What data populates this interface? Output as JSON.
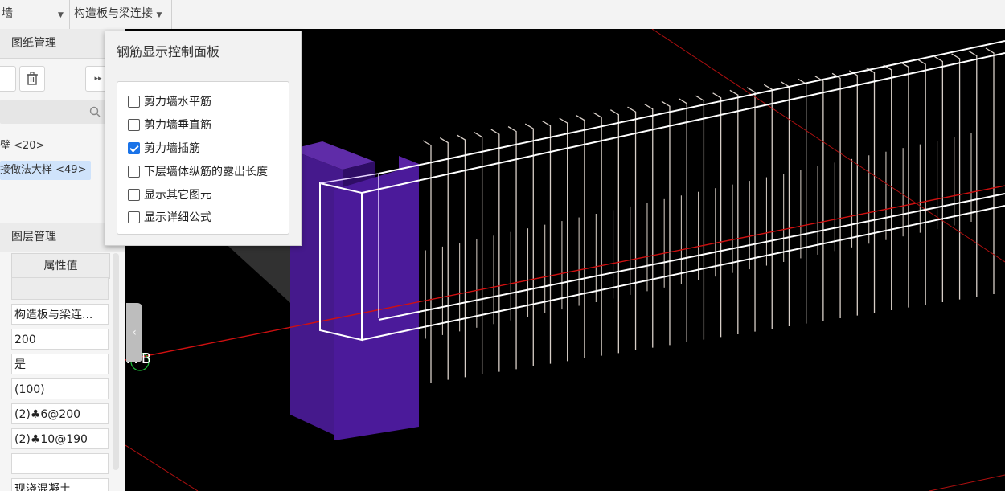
{
  "toolbar": {
    "segment1_label": "墙",
    "segment2_label": "构造板与梁连接"
  },
  "drawing_panel": {
    "title": "图纸管理",
    "items": [
      {
        "label": "壁 <20>",
        "selected": false
      },
      {
        "label": "接做法大样 <49>",
        "selected": true
      }
    ]
  },
  "layer_panel": {
    "title": "图层管理"
  },
  "properties": {
    "header": "属性值",
    "rows": [
      "构造板与梁连...",
      "200",
      "是",
      "(100)",
      "(2)♣6@200",
      "(2)♣10@190",
      "",
      "现浇混凝土"
    ]
  },
  "viewport": {
    "axis_label": "A-B"
  },
  "rebar_panel": {
    "title": "钢筋显示控制面板",
    "options": [
      {
        "label": "剪力墙水平筋",
        "checked": false
      },
      {
        "label": "剪力墙垂直筋",
        "checked": false
      },
      {
        "label": "剪力墙插筋",
        "checked": true
      },
      {
        "label": "下层墙体纵筋的露出长度",
        "checked": false
      },
      {
        "label": "显示其它图元",
        "checked": false
      },
      {
        "label": "显示详细公式",
        "checked": false
      }
    ]
  },
  "colors": {
    "accent": "#1a73e8",
    "column": "#4a1a8c",
    "axis_line": "#d01010"
  }
}
